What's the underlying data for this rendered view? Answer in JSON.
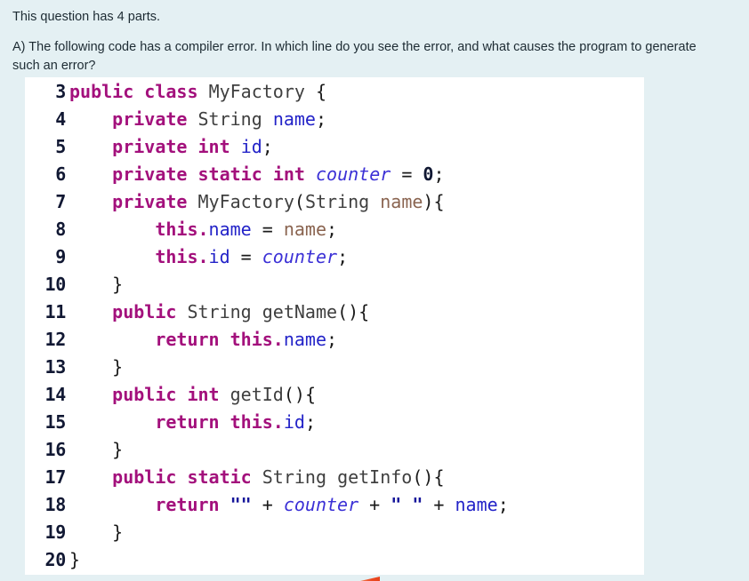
{
  "question": {
    "intro": "This question has 4 parts.",
    "prompt": "A) The following code has a compiler error. In which line do you see the error, and what causes the program to generate such an error?"
  },
  "colors": {
    "page_background": "#e4f0f3",
    "code_background": "#ffffff",
    "keyword": "#a3107c",
    "type": "#3f3f3f",
    "field": "#2323c8",
    "static_field": "#3b30d6",
    "parameter": "#8a6450",
    "string": "#16169a",
    "line_number": "#111833",
    "marker": "#ec4a22"
  },
  "code": {
    "language": "java",
    "first_line_number": 3,
    "last_line_number": 20,
    "lines": [
      {
        "number": "3",
        "tokens": [
          {
            "t": "public",
            "c": "kw"
          },
          {
            "t": " ",
            "c": "pun"
          },
          {
            "t": "class",
            "c": "kw"
          },
          {
            "t": " ",
            "c": "pun"
          },
          {
            "t": "MyFactory",
            "c": "typ"
          },
          {
            "t": " {",
            "c": "pun"
          }
        ]
      },
      {
        "number": "4",
        "tokens": [
          {
            "t": "    ",
            "c": "pun"
          },
          {
            "t": "private",
            "c": "kw"
          },
          {
            "t": " ",
            "c": "pun"
          },
          {
            "t": "String",
            "c": "typ"
          },
          {
            "t": " ",
            "c": "pun"
          },
          {
            "t": "name",
            "c": "fld"
          },
          {
            "t": ";",
            "c": "pun"
          }
        ]
      },
      {
        "number": "5",
        "tokens": [
          {
            "t": "    ",
            "c": "pun"
          },
          {
            "t": "private",
            "c": "kw"
          },
          {
            "t": " ",
            "c": "pun"
          },
          {
            "t": "int",
            "c": "kw"
          },
          {
            "t": " ",
            "c": "pun"
          },
          {
            "t": "id",
            "c": "fld"
          },
          {
            "t": ";",
            "c": "pun"
          }
        ]
      },
      {
        "number": "6",
        "tokens": [
          {
            "t": "    ",
            "c": "pun"
          },
          {
            "t": "private",
            "c": "kw"
          },
          {
            "t": " ",
            "c": "pun"
          },
          {
            "t": "static",
            "c": "kw"
          },
          {
            "t": " ",
            "c": "pun"
          },
          {
            "t": "int",
            "c": "kw"
          },
          {
            "t": " ",
            "c": "pun"
          },
          {
            "t": "counter",
            "c": "sfld"
          },
          {
            "t": " = ",
            "c": "op"
          },
          {
            "t": "0",
            "c": "num"
          },
          {
            "t": ";",
            "c": "pun"
          }
        ]
      },
      {
        "number": "7",
        "tokens": [
          {
            "t": "    ",
            "c": "pun"
          },
          {
            "t": "private",
            "c": "kw"
          },
          {
            "t": " ",
            "c": "pun"
          },
          {
            "t": "MyFactory",
            "c": "typ"
          },
          {
            "t": "(",
            "c": "pun"
          },
          {
            "t": "String",
            "c": "typ"
          },
          {
            "t": " ",
            "c": "pun"
          },
          {
            "t": "name",
            "c": "prm"
          },
          {
            "t": "){",
            "c": "pun"
          }
        ]
      },
      {
        "number": "8",
        "tokens": [
          {
            "t": "        ",
            "c": "pun"
          },
          {
            "t": "this",
            "c": "kw"
          },
          {
            "t": ".",
            "c": "kw"
          },
          {
            "t": "name",
            "c": "fld"
          },
          {
            "t": " = ",
            "c": "op"
          },
          {
            "t": "name",
            "c": "prm"
          },
          {
            "t": ";",
            "c": "pun"
          }
        ]
      },
      {
        "number": "9",
        "tokens": [
          {
            "t": "        ",
            "c": "pun"
          },
          {
            "t": "this",
            "c": "kw"
          },
          {
            "t": ".",
            "c": "kw"
          },
          {
            "t": "id",
            "c": "fld"
          },
          {
            "t": " = ",
            "c": "op"
          },
          {
            "t": "counter",
            "c": "sfld"
          },
          {
            "t": ";",
            "c": "pun"
          }
        ]
      },
      {
        "number": "10",
        "tokens": [
          {
            "t": "    }",
            "c": "pun"
          }
        ]
      },
      {
        "number": "11",
        "tokens": [
          {
            "t": "    ",
            "c": "pun"
          },
          {
            "t": "public",
            "c": "kw"
          },
          {
            "t": " ",
            "c": "pun"
          },
          {
            "t": "String",
            "c": "typ"
          },
          {
            "t": " ",
            "c": "pun"
          },
          {
            "t": "getName",
            "c": "mth"
          },
          {
            "t": "(){",
            "c": "pun"
          }
        ]
      },
      {
        "number": "12",
        "tokens": [
          {
            "t": "        ",
            "c": "pun"
          },
          {
            "t": "return",
            "c": "kw"
          },
          {
            "t": " ",
            "c": "pun"
          },
          {
            "t": "this",
            "c": "kw"
          },
          {
            "t": ".",
            "c": "kw"
          },
          {
            "t": "name",
            "c": "fld"
          },
          {
            "t": ";",
            "c": "pun"
          }
        ]
      },
      {
        "number": "13",
        "tokens": [
          {
            "t": "    }",
            "c": "pun"
          }
        ]
      },
      {
        "number": "14",
        "tokens": [
          {
            "t": "    ",
            "c": "pun"
          },
          {
            "t": "public",
            "c": "kw"
          },
          {
            "t": " ",
            "c": "pun"
          },
          {
            "t": "int",
            "c": "kw"
          },
          {
            "t": " ",
            "c": "pun"
          },
          {
            "t": "getId",
            "c": "mth"
          },
          {
            "t": "(){",
            "c": "pun"
          }
        ]
      },
      {
        "number": "15",
        "tokens": [
          {
            "t": "        ",
            "c": "pun"
          },
          {
            "t": "return",
            "c": "kw"
          },
          {
            "t": " ",
            "c": "pun"
          },
          {
            "t": "this",
            "c": "kw"
          },
          {
            "t": ".",
            "c": "kw"
          },
          {
            "t": "id",
            "c": "fld"
          },
          {
            "t": ";",
            "c": "pun"
          }
        ]
      },
      {
        "number": "16",
        "tokens": [
          {
            "t": "    }",
            "c": "pun"
          }
        ]
      },
      {
        "number": "17",
        "tokens": [
          {
            "t": "    ",
            "c": "pun"
          },
          {
            "t": "public",
            "c": "kw"
          },
          {
            "t": " ",
            "c": "pun"
          },
          {
            "t": "static",
            "c": "kw"
          },
          {
            "t": " ",
            "c": "pun"
          },
          {
            "t": "String",
            "c": "typ"
          },
          {
            "t": " ",
            "c": "pun"
          },
          {
            "t": "getInfo",
            "c": "mth"
          },
          {
            "t": "(){",
            "c": "pun"
          }
        ]
      },
      {
        "number": "18",
        "tokens": [
          {
            "t": "        ",
            "c": "pun"
          },
          {
            "t": "return",
            "c": "kw"
          },
          {
            "t": " ",
            "c": "pun"
          },
          {
            "t": "\"\"",
            "c": "str"
          },
          {
            "t": " + ",
            "c": "op"
          },
          {
            "t": "counter",
            "c": "sfld"
          },
          {
            "t": " + ",
            "c": "op"
          },
          {
            "t": "\" \"",
            "c": "str"
          },
          {
            "t": " + ",
            "c": "op"
          },
          {
            "t": "name",
            "c": "fld"
          },
          {
            "t": ";",
            "c": "pun"
          }
        ]
      },
      {
        "number": "19",
        "tokens": [
          {
            "t": "    }",
            "c": "pun"
          }
        ]
      },
      {
        "number": "20",
        "tokens": [
          {
            "t": "}",
            "c": "pun"
          }
        ]
      }
    ]
  }
}
